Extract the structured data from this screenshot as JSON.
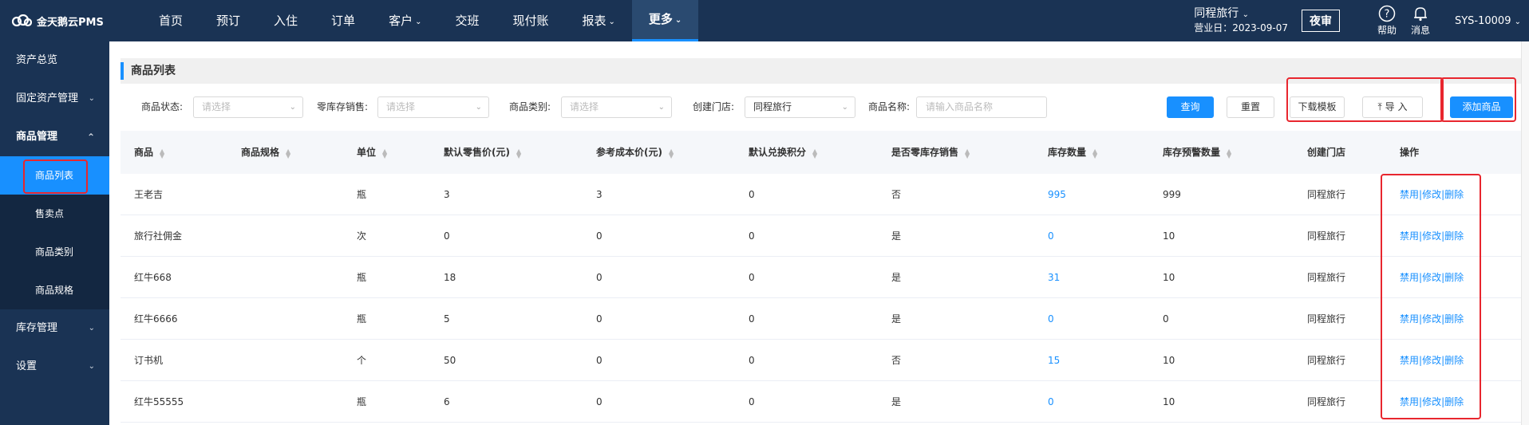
{
  "brand": {
    "logo_text": "金天鹅云PMS"
  },
  "nav": [
    {
      "label": "首页",
      "chevron": false,
      "active": false
    },
    {
      "label": "预订",
      "chevron": false,
      "active": false
    },
    {
      "label": "入住",
      "chevron": false,
      "active": false
    },
    {
      "label": "订单",
      "chevron": false,
      "active": false
    },
    {
      "label": "客户",
      "chevron": true,
      "active": false
    },
    {
      "label": "交班",
      "chevron": false,
      "active": false
    },
    {
      "label": "现付账",
      "chevron": false,
      "active": false
    },
    {
      "label": "报表",
      "chevron": true,
      "active": false
    },
    {
      "label": "更多",
      "chevron": true,
      "active": true
    }
  ],
  "header_right": {
    "hotel": "同程旅行",
    "business_date": "营业日：2023-09-07",
    "night_audit": "夜审",
    "help": "帮助",
    "messages": "消息",
    "user": "SYS-10009"
  },
  "sidebar": {
    "items": [
      {
        "label": "资产总览"
      },
      {
        "label": "固定资产管理"
      },
      {
        "label": "商品管理"
      },
      {
        "label": "库存管理"
      },
      {
        "label": "设置"
      }
    ],
    "sub_items": [
      {
        "label": "商品列表"
      },
      {
        "label": "售卖点"
      },
      {
        "label": "商品类别"
      },
      {
        "label": "商品规格"
      }
    ]
  },
  "page": {
    "title": "商品列表"
  },
  "filters": {
    "status_label": "商品状态:",
    "status_placeholder": "请选择",
    "zero_stock_label": "零库存销售:",
    "zero_stock_placeholder": "请选择",
    "category_label": "商品类别:",
    "category_placeholder": "请选择",
    "store_label": "创建门店:",
    "store_value": "同程旅行",
    "name_label": "商品名称:",
    "name_placeholder": "请输入商品名称"
  },
  "buttons": {
    "query": "查询",
    "reset": "重置",
    "download_template": "下载模板",
    "import": "导 入",
    "add_product": "添加商品"
  },
  "table": {
    "columns": [
      "商品",
      "商品规格",
      "单位",
      "默认零售价(元)",
      "参考成本价(元)",
      "默认兑换积分",
      "是否零库存销售",
      "库存数量",
      "库存预警数量",
      "创建门店",
      "操作"
    ],
    "rows": [
      {
        "name": "王老吉",
        "spec": "",
        "unit": "瓶",
        "price": "3",
        "cost": "3",
        "points": "0",
        "zero_stock": "否",
        "stock": "995",
        "warn": "999",
        "store": "同程旅行"
      },
      {
        "name": "旅行社佣金",
        "spec": "",
        "unit": "次",
        "price": "0",
        "cost": "0",
        "points": "0",
        "zero_stock": "是",
        "stock": "0",
        "warn": "10",
        "store": "同程旅行"
      },
      {
        "name": "红牛668",
        "spec": "",
        "unit": "瓶",
        "price": "18",
        "cost": "0",
        "points": "0",
        "zero_stock": "是",
        "stock": "31",
        "warn": "10",
        "store": "同程旅行"
      },
      {
        "name": "红牛6666",
        "spec": "",
        "unit": "瓶",
        "price": "5",
        "cost": "0",
        "points": "0",
        "zero_stock": "是",
        "stock": "0",
        "warn": "0",
        "store": "同程旅行"
      },
      {
        "name": "订书机",
        "spec": "",
        "unit": "个",
        "price": "50",
        "cost": "0",
        "points": "0",
        "zero_stock": "否",
        "stock": "15",
        "warn": "10",
        "store": "同程旅行"
      },
      {
        "name": "红牛55555",
        "spec": "",
        "unit": "瓶",
        "price": "6",
        "cost": "0",
        "points": "0",
        "zero_stock": "是",
        "stock": "0",
        "warn": "10",
        "store": "同程旅行"
      }
    ],
    "ops": {
      "disable": "禁用",
      "edit": "修改",
      "delete": "删除",
      "sep": "|"
    }
  },
  "colors": {
    "nav_bg": "#1a3354",
    "accent": "#1890ff",
    "highlight": "#e8262e"
  }
}
